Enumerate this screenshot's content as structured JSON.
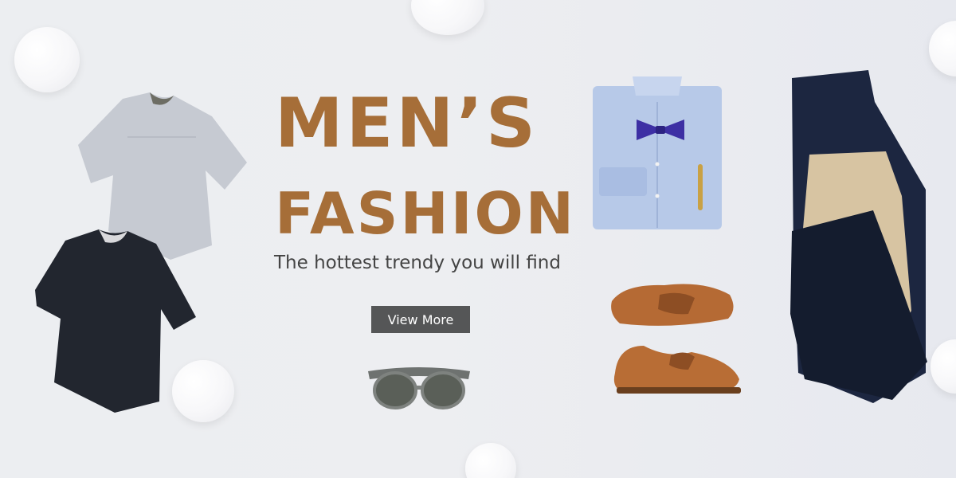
{
  "hero": {
    "title_line1": "MEN’S",
    "title_line2": "FASHION",
    "tagline": "The hottest trendy you will find",
    "cta_label": "View More"
  },
  "colors": {
    "background": "#ecedf0",
    "title": "#a66e38",
    "button_bg": "#555657",
    "button_text": "#ffffff",
    "tagline": "#444444"
  },
  "products": [
    {
      "name": "grey-tshirt"
    },
    {
      "name": "black-tshirt"
    },
    {
      "name": "blue-dress-shirt"
    },
    {
      "name": "bow-tie"
    },
    {
      "name": "navy-chinos"
    },
    {
      "name": "khaki-chinos"
    },
    {
      "name": "brown-oxford-shoes"
    },
    {
      "name": "sunglasses"
    }
  ]
}
